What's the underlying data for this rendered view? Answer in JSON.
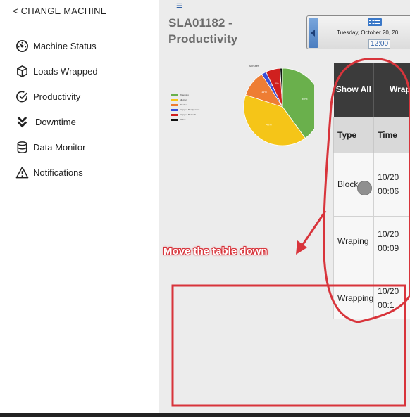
{
  "sidebar": {
    "change_machine": "< CHANGE MACHINE",
    "items": [
      {
        "label": "Machine Status",
        "icon": "gauge-icon"
      },
      {
        "label": "Loads Wrapped",
        "icon": "cube-icon"
      },
      {
        "label": "Productivity",
        "icon": "check-circle-icon"
      },
      {
        "label": "Downtime",
        "icon": "double-chevron-down-icon"
      },
      {
        "label": "Data Monitor",
        "icon": "database-icon"
      },
      {
        "label": "Notifications",
        "icon": "warning-icon"
      }
    ]
  },
  "header": {
    "menu_icon": "≡",
    "title_line1": "SLA01182 -",
    "title_line2": "Productivity"
  },
  "date_picker": {
    "date": "Tuesday, October 20, 20",
    "time": "12:00"
  },
  "chart_data": {
    "type": "pie",
    "title": "",
    "caption": "Minutes",
    "slices": [
      {
        "label": "Wrapping",
        "value": 40,
        "color": "#6ab04c"
      },
      {
        "label": "Idle/cart",
        "value": 40,
        "color": "#f5c518"
      },
      {
        "label": "Blocked",
        "value": 11,
        "color": "#ee7d33"
      },
      {
        "label": "Stopped By Operator",
        "value": 2,
        "color": "#3a4fd8"
      },
      {
        "label": "Stopped By Fault",
        "value": 6,
        "color": "#d0201f"
      },
      {
        "label": "Offline",
        "value": 1,
        "color": "#111111"
      }
    ],
    "slice_labels": [
      "40%",
      "40%",
      "11%",
      "2%",
      "6%",
      ""
    ],
    "legend_position": "left"
  },
  "table": {
    "header_buttons": [
      "Show All",
      "Wrapp"
    ],
    "columns": [
      "Type",
      "Time"
    ],
    "rows": [
      {
        "type": "Blocked",
        "date": "10/20",
        "time": "00:06"
      },
      {
        "type": "Wraping",
        "date": "10/20",
        "time": "00:09"
      },
      {
        "type": "Wrapping",
        "date": "10/20",
        "time": "00:1"
      }
    ]
  },
  "annotation": {
    "text": "Move the table down",
    "color": "#d8343b"
  }
}
